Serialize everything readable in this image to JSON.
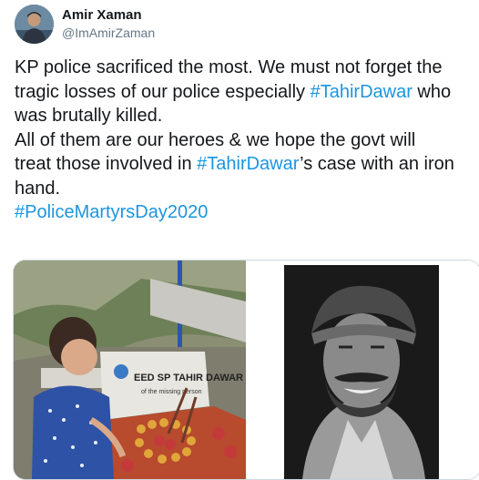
{
  "tweet": {
    "author": {
      "display_name": "Amir Xaman",
      "handle": "@ImAmirZaman",
      "avatar_icon": "person-portrait-icon"
    },
    "text_lines": [
      [
        {
          "t": "KP police sacrificed the most. We must not forget the"
        }
      ],
      [
        {
          "t": "tragic losses of our police especially "
        },
        {
          "t": "#TahirDawar",
          "tag": true
        },
        {
          "t": " who"
        }
      ],
      [
        {
          "t": "was brutally killed."
        }
      ],
      [
        {
          "t": "All of them are our heroes & we hope the govt will"
        }
      ],
      [
        {
          "t": "treat those involved in "
        },
        {
          "t": "#TahirDawar",
          "tag": true
        },
        {
          "t": "’s case with an iron"
        }
      ],
      [
        {
          "t": "hand."
        }
      ],
      [
        {
          "t": " "
        }
      ],
      [
        {
          "t": "#PoliceMartyrsDay2020",
          "tag": true
        }
      ]
    ],
    "hashtag_color": "#1b95e0",
    "media": {
      "left_image": {
        "plaque_line1": "EED SP TAHIR DAWAR",
        "plaque_line2": "of the missing person"
      },
      "right_image": {
        "description_icon": "portrait-photo-icon"
      }
    }
  }
}
